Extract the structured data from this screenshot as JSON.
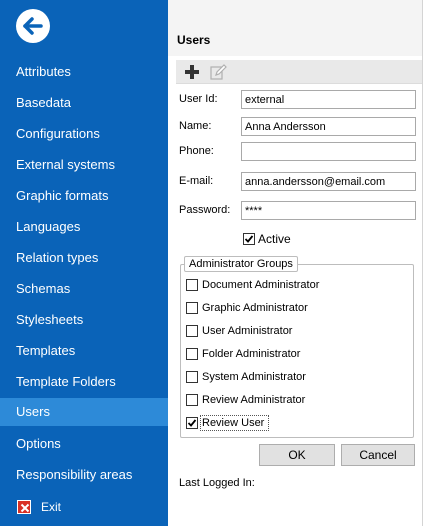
{
  "sidebar": {
    "back_icon": "back-arrow-icon",
    "items": [
      {
        "label": "Attributes",
        "selected": false
      },
      {
        "label": "Basedata",
        "selected": false
      },
      {
        "label": "Configurations",
        "selected": false
      },
      {
        "label": "External systems",
        "selected": false
      },
      {
        "label": "Graphic formats",
        "selected": false
      },
      {
        "label": "Languages",
        "selected": false
      },
      {
        "label": "Relation types",
        "selected": false
      },
      {
        "label": "Schemas",
        "selected": false
      },
      {
        "label": "Stylesheets",
        "selected": false
      },
      {
        "label": "Templates",
        "selected": false
      },
      {
        "label": "Template Folders",
        "selected": false
      },
      {
        "label": "Users",
        "selected": true
      },
      {
        "label": "Options",
        "selected": false
      },
      {
        "label": "Responsibility areas",
        "selected": false
      }
    ],
    "exit": {
      "label": "Exit",
      "icon": "exit-icon"
    },
    "colors": {
      "background": "#0a63b8",
      "selected": "#2d8ad8"
    }
  },
  "header": {
    "title": "Users"
  },
  "toolbar": {
    "add_icon": "plus-icon",
    "edit_icon": "edit-icon"
  },
  "form": {
    "user_id": {
      "label": "User Id:",
      "value": "external"
    },
    "name": {
      "label": "Name:",
      "value": "Anna Andersson"
    },
    "phone": {
      "label": "Phone:",
      "value": ""
    },
    "email": {
      "label": "E-mail:",
      "value": "anna.andersson@email.com"
    },
    "password": {
      "label": "Password:",
      "value": "****"
    },
    "active": {
      "label": "Active",
      "checked": true
    }
  },
  "admin_groups": {
    "title": "Administrator Groups",
    "items": [
      {
        "label": "Document Administrator",
        "checked": false
      },
      {
        "label": "Graphic Administrator",
        "checked": false
      },
      {
        "label": "User Administrator",
        "checked": false
      },
      {
        "label": "Folder Administrator",
        "checked": false
      },
      {
        "label": "System Administrator",
        "checked": false
      },
      {
        "label": "Review Administrator",
        "checked": false
      },
      {
        "label": "Review User",
        "checked": true
      }
    ]
  },
  "buttons": {
    "ok": "OK",
    "cancel": "Cancel"
  },
  "last_logged_in": {
    "label": "Last Logged In:",
    "value": ""
  }
}
